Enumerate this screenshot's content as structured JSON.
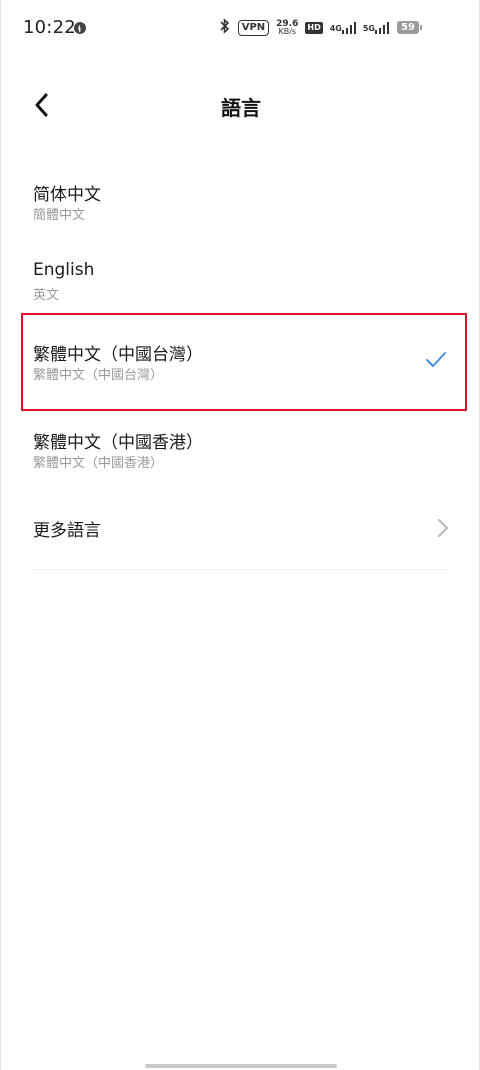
{
  "status_bar": {
    "time": "10:22",
    "vpn": "VPN",
    "net_speed_value": "29.6",
    "net_speed_unit": "KB/s",
    "hd": "HD",
    "sim1_type": "4G",
    "sim2_type": "5G",
    "battery": "59"
  },
  "header": {
    "title": "語言"
  },
  "languages": [
    {
      "primary": "简体中文",
      "secondary": "簡體中文",
      "selected": false
    },
    {
      "primary": "English",
      "secondary": "英文",
      "selected": false
    },
    {
      "primary": "繁體中文（中國台灣）",
      "secondary": "繁體中文（中國台灣）",
      "selected": true
    },
    {
      "primary": "繁體中文（中國香港）",
      "secondary": "繁體中文（中國香港）",
      "selected": false
    }
  ],
  "more_languages": {
    "label": "更多語言"
  },
  "colors": {
    "accent": "#4a90e2",
    "highlight_border": "#e0112b",
    "secondary_text": "#9b9b9b"
  }
}
